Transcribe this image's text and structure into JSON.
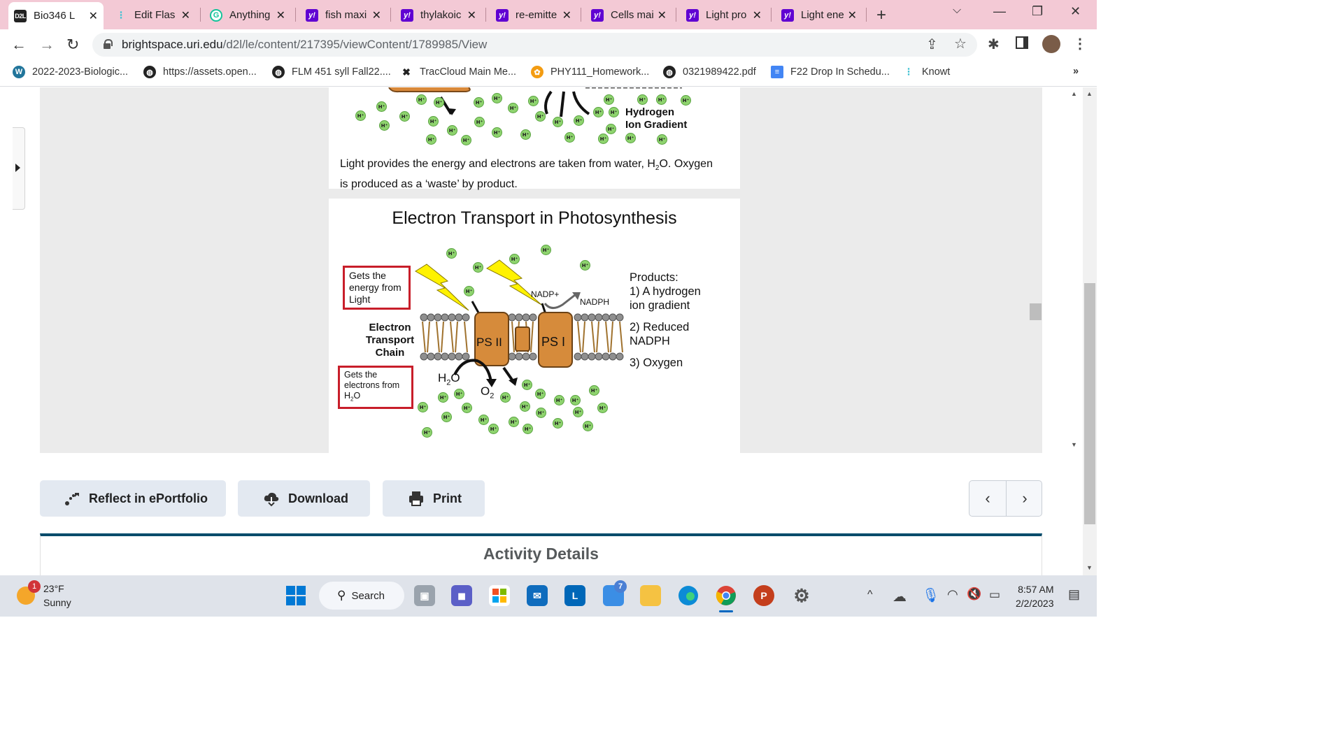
{
  "tabs": [
    {
      "title": "Bio346 L",
      "favicon": "D2L",
      "active": true
    },
    {
      "title": "Edit Flas",
      "favicon": "knowt",
      "active": false
    },
    {
      "title": "Anything",
      "favicon": "G",
      "active": false
    },
    {
      "title": "fish maxi",
      "favicon": "y!",
      "active": false
    },
    {
      "title": "thylakoic",
      "favicon": "y!",
      "active": false
    },
    {
      "title": "re-emitte",
      "favicon": "y!",
      "active": false
    },
    {
      "title": "Cells mai",
      "favicon": "y!",
      "active": false
    },
    {
      "title": "Light pro",
      "favicon": "y!",
      "active": false
    },
    {
      "title": "Light ene",
      "favicon": "y!",
      "active": false
    }
  ],
  "address": {
    "host": "brightspace.uri.edu",
    "path": "/d2l/le/content/217395/viewContent/1789985/View"
  },
  "bookmarks": [
    "2022-2023-Biologic...",
    "https://assets.open...",
    "FLM 451 syll Fall22....",
    "TracCloud Main Me...",
    "PHY111_Homework...",
    "0321989422.pdf",
    "F22 Drop In Schedu...",
    "Knowt"
  ],
  "slide1": {
    "gradient_label_line1": "Hydrogen",
    "gradient_label_line2": "Ion Gradient",
    "caption_line1": "Light provides the energy and electrons are taken from water, H",
    "caption_sub": "2",
    "caption_line1_end": "O.  Oxygen",
    "caption_line2": "is produced as a ‘waste’ by product."
  },
  "slide2": {
    "title": "Electron Transport in Photosynthesis",
    "box_light": [
      "Gets the",
      "energy from",
      "Light"
    ],
    "box_water": [
      "Gets the",
      "electrons from",
      "H",
      "2",
      "O"
    ],
    "etc_label": [
      "Electron",
      "Transport",
      "Chain"
    ],
    "ps2": "PS II",
    "ps1": "PS I",
    "nadp": "NADP+",
    "nadph": "NADPH",
    "h2o": "H",
    "h2o_sub": "2",
    "h2o_end": "O",
    "o2": "O",
    "o2_sub": "2",
    "ion": "H⁺",
    "products_title": "Products:",
    "product1": [
      "1) A hydrogen",
      "ion gradient"
    ],
    "product2": [
      "2) Reduced",
      "NADPH"
    ],
    "product3": "3) Oxygen"
  },
  "actions": {
    "reflect": "Reflect in ePortfolio",
    "download": "Download",
    "print": "Print"
  },
  "activity_details": "Activity Details",
  "taskbar": {
    "temp": "23°F",
    "condition": "Sunny",
    "notification_count": "1",
    "search": "Search",
    "teams_badge": "7",
    "time": "8:57 AM",
    "date": "2/2/2023"
  }
}
